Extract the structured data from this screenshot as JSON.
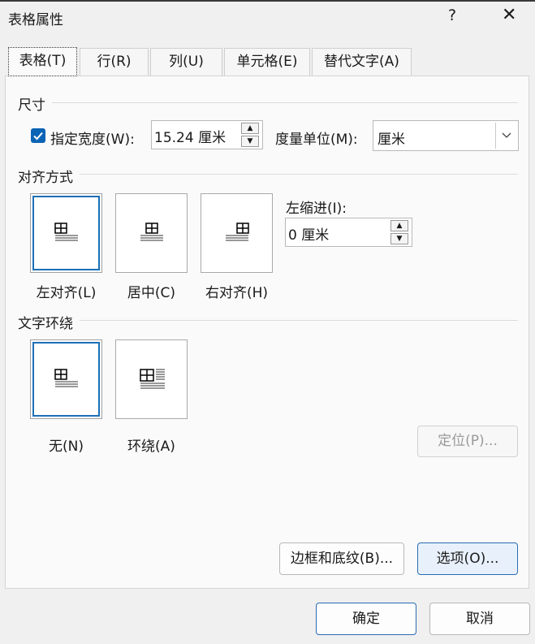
{
  "window": {
    "title": "表格属性",
    "help": "?",
    "close": "✕"
  },
  "tabs": [
    {
      "label": "表格(T)",
      "active": true
    },
    {
      "label": "行(R)",
      "active": false
    },
    {
      "label": "列(U)",
      "active": false
    },
    {
      "label": "单元格(E)",
      "active": false
    },
    {
      "label": "替代文字(A)",
      "active": false
    }
  ],
  "size": {
    "section_label": "尺寸",
    "width_checkbox_label": "指定宽度(W):",
    "width_checked": true,
    "width_value": "15.24 厘米",
    "unit_label": "度量单位(M):",
    "unit_value": "厘米"
  },
  "alignment": {
    "section_label": "对齐方式",
    "options": [
      "左对齐(L)",
      "居中(C)",
      "右对齐(H)"
    ],
    "selected": "左对齐(L)",
    "indent_label": "左缩进(I):",
    "indent_value": "0 厘米"
  },
  "wrap": {
    "section_label": "文字环绕",
    "options": [
      "无(N)",
      "环绕(A)"
    ],
    "selected": "无(N)",
    "position_button": "定位(P)..."
  },
  "buttons": {
    "borders": "边框和底纹(B)...",
    "options": "选项(O)...",
    "ok": "确定",
    "cancel": "取消"
  },
  "icons": {
    "spin_up": "up-arrow-icon",
    "spin_down": "down-arrow-icon",
    "dropdown": "chevron-down-icon",
    "checkmark": "checkmark-icon"
  },
  "colors": {
    "accent": "#0b63b6",
    "background": "#f0f0f0",
    "panel": "#fafafa"
  }
}
